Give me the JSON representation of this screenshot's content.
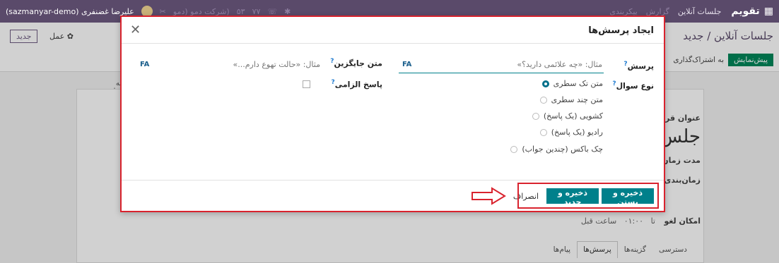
{
  "navbar": {
    "brand": "تقویم",
    "menu": [
      "جلسات آنلاین",
      "گزارش",
      "پیکربندی"
    ],
    "chip1": "۵۳",
    "chip2": "۷۷",
    "user": "علیرضا غضنفری (sazmanyar-demo)",
    "company": "(شرکت دمو (دمو"
  },
  "control_panel": {
    "breadcrumb": "جلسات آنلاین / جدید",
    "new_button": "جدید",
    "action_label": "عمل",
    "preview_button": "پیش‌نمایش",
    "share_button": "به اشتراک‌گذاری"
  },
  "form_bg": {
    "side_label": "به سایت",
    "title_label": "عنوان قرار",
    "title_value": "جلس",
    "duration_label": "مدت زمان",
    "schedule_label": "زمان‌بندی",
    "cancel_label": "امکان لغو",
    "cancel_to": "تا",
    "cancel_value": "۰۱:۰۰",
    "cancel_suffix": "ساعت قبل",
    "tabs": [
      "دسترسی",
      "گزینه‌ها",
      "پرسش‌ها",
      "پیام‌ها"
    ]
  },
  "modal": {
    "title": "ایجاد پرسش‌ها",
    "question_label": "پرسش",
    "question_placeholder": "مثال: «چه علائمی دارید؟»",
    "placeholder_label": "متن جایگزین",
    "placeholder_placeholder": "مثال: «حالت تهوع دارم...»",
    "lang_code": "FA",
    "type_label": "نوع سوال",
    "required_label": "پاسخ الزامی",
    "types": [
      {
        "label": "متن تک سطری",
        "checked": true
      },
      {
        "label": "متن چند سطری",
        "checked": false
      },
      {
        "label": "کشویی (یک پاسخ)",
        "checked": false
      },
      {
        "label": "رادیو (یک پاسخ)",
        "checked": false
      },
      {
        "label": "چک باکس (چندین جواب)",
        "checked": false
      }
    ],
    "save_close": "ذخیره و بستن",
    "save_new": "ذخیره و جدید",
    "discard": "انصراف"
  },
  "colors": {
    "navbar": "#5a4a6a",
    "primary": "#00808b",
    "highlight": "#d9232e",
    "preview": "#00875a"
  }
}
